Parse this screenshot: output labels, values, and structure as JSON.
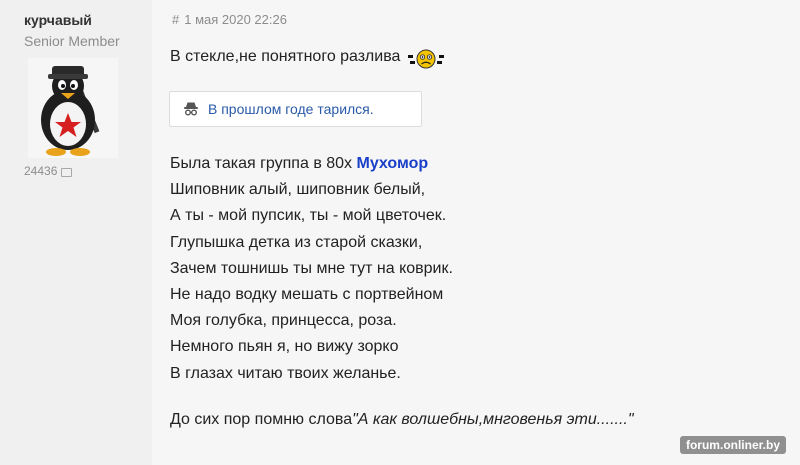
{
  "author": {
    "name": "курчавый",
    "rank": "Senior Member",
    "post_count": "24436",
    "avatar_icon": "penguin-red-star-avatar"
  },
  "post": {
    "hash": "#",
    "date": "1 мая 2020 22:26",
    "first_line": "В стекле,не понятного разлива",
    "smiley_icon": "hungover-smiley-icon",
    "spoiler": {
      "label": "В прошлом годе тарился.",
      "icon": "spy-hat-icon"
    },
    "poem": {
      "line1_text": "Была такая группа в 80х ",
      "line1_mention": "Мухомор",
      "lines": [
        "Шиповник алый, шиповник белый,",
        "А ты - мой пупсик, ты - мой цветочек.",
        "Глупышка детка из старой сказки,",
        "Зачем тошнишь ты мне тут на коврик.",
        "Не надо водку мешать с портвейном",
        "Моя голубка, принцесса, роза.",
        "Немного пьян я, но вижу зорко",
        "В глазах читаю твоих желанье."
      ]
    },
    "closing_text": "До сих пор помню слова",
    "closing_quote": "\"А как волшебны,мнговенья эти.......\""
  },
  "watermark": "forum.onliner.by",
  "colors": {
    "author_bg": "#f0f0f0",
    "content_bg": "#f6f6f6",
    "link": "#2a5aa8",
    "mention": "#1a3fc8"
  }
}
